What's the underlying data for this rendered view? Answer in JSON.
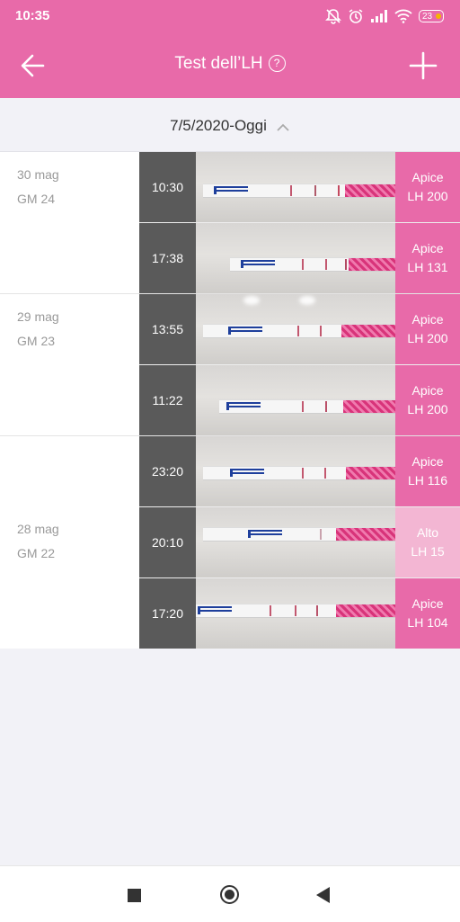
{
  "status": {
    "time": "10:35",
    "battery": "23"
  },
  "header": {
    "title": "Test dell’LH",
    "back_icon": "arrow-left-icon",
    "add_icon": "plus-icon",
    "help_icon": "help-circle-icon"
  },
  "filter": {
    "date_range": "7/5/2020-Oggi"
  },
  "days": [
    {
      "date": "30 mag",
      "gm": "GM 24",
      "tests": [
        {
          "time": "10:30",
          "level": "Apice",
          "lh": "LH 200"
        },
        {
          "time": "17:38",
          "level": "Apice",
          "lh": "LH 131"
        }
      ]
    },
    {
      "date": "29 mag",
      "gm": "GM 23",
      "tests": [
        {
          "time": "13:55",
          "level": "Apice",
          "lh": "LH 200"
        },
        {
          "time": "11:22",
          "level": "Apice",
          "lh": "LH 200"
        }
      ]
    },
    {
      "date": "28 mag",
      "gm": "GM 22",
      "tests": [
        {
          "time": "23:20",
          "level": "Apice",
          "lh": "LH 116"
        },
        {
          "time": "20:10",
          "level": "Alto",
          "lh": "LH 15"
        },
        {
          "time": "17:20",
          "level": "Apice",
          "lh": "LH 104"
        }
      ]
    }
  ],
  "colors": {
    "accent": "#e86aa9",
    "accent_light": "#f3b6d3",
    "time_cell": "#5a5a5a"
  }
}
